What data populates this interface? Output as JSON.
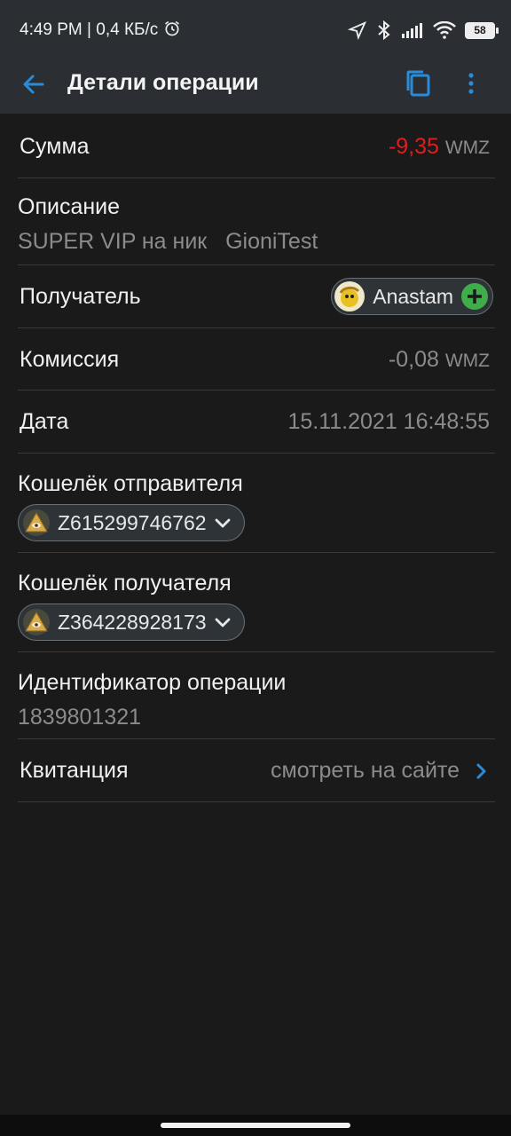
{
  "status_bar": {
    "time": "4:49 PM | 0,4 КБ/с",
    "battery": "58",
    "icons": [
      "alarm-icon",
      "location-icon",
      "bluetooth-icon",
      "signal-icon",
      "wifi-icon",
      "battery-icon"
    ]
  },
  "app_bar": {
    "title": "Детали операции",
    "icons": [
      "back-arrow-icon",
      "copy-icon",
      "more-vert-icon"
    ]
  },
  "rows": {
    "amount": {
      "label": "Сумма",
      "value": "-9,35",
      "unit": "WMZ"
    },
    "description": {
      "label": "Описание",
      "value": "SUPER VIP на ник   GioniTest"
    },
    "recipient": {
      "label": "Получатель",
      "name": "Anastam"
    },
    "commission": {
      "label": "Комиссия",
      "value": "-0,08",
      "unit": "WMZ"
    },
    "date": {
      "label": "Дата",
      "value": "15.11.2021 16:48:55"
    },
    "sender_wallet": {
      "label": "Кошелёк отправителя",
      "value": "Z615299746762"
    },
    "recipient_wallet": {
      "label": "Кошелёк получателя",
      "value": "Z364228928173"
    },
    "operation_id": {
      "label": "Идентификатор операции",
      "value": "1839801321"
    },
    "receipt": {
      "label": "Квитанция",
      "link": "смотреть на сайте"
    }
  },
  "colors": {
    "background": "#1a1a1a",
    "appbar": "#2b2f33",
    "accent_blue": "#2a8cd8",
    "negative_red": "#e21c1c",
    "muted_text": "#8b8b8b",
    "add_green": "#3fae4a"
  }
}
